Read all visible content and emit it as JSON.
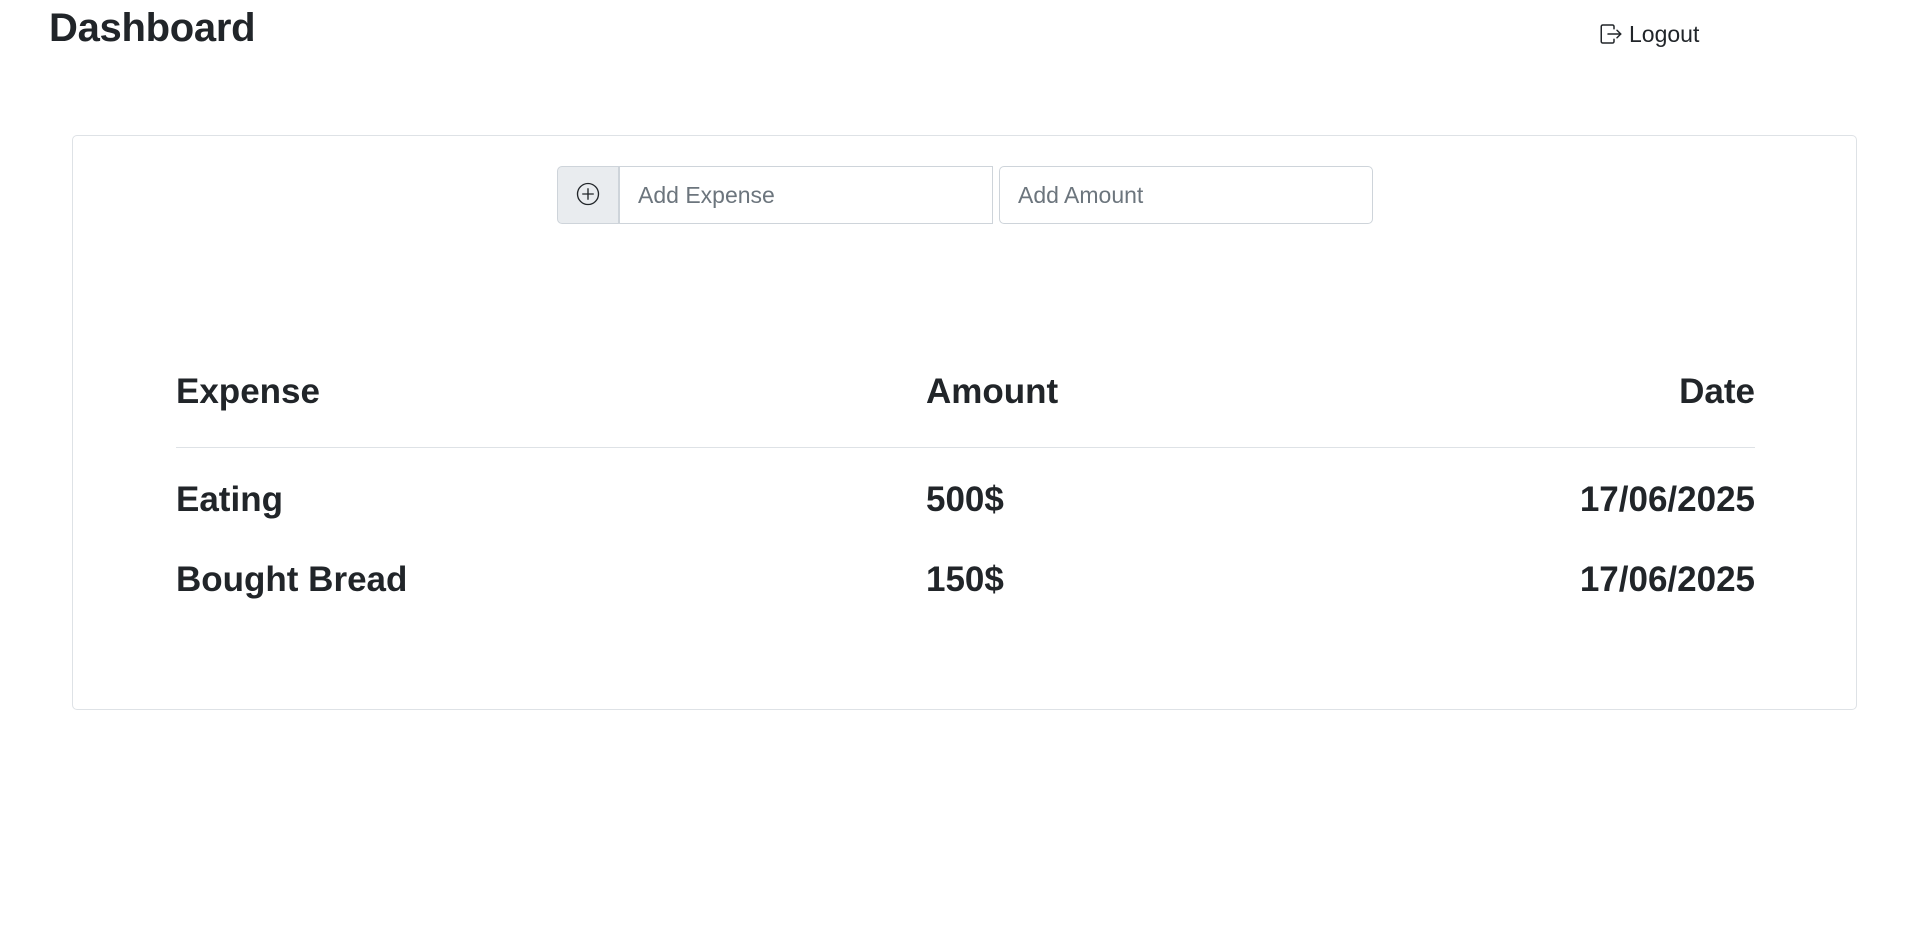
{
  "header": {
    "title": "Dashboard",
    "logout_label": "Logout"
  },
  "form": {
    "add_button_icon": "plus-circle-icon",
    "expense_placeholder": "Add Expense",
    "amount_placeholder": "Add Amount",
    "expense_value": "",
    "amount_value": ""
  },
  "table": {
    "columns": [
      "Expense",
      "Amount",
      "Date"
    ],
    "rows": [
      {
        "expense": "Eating",
        "amount": "500$",
        "date": "17/06/2025"
      },
      {
        "expense": "Bought Bread",
        "amount": "150$",
        "date": "17/06/2025"
      }
    ]
  }
}
